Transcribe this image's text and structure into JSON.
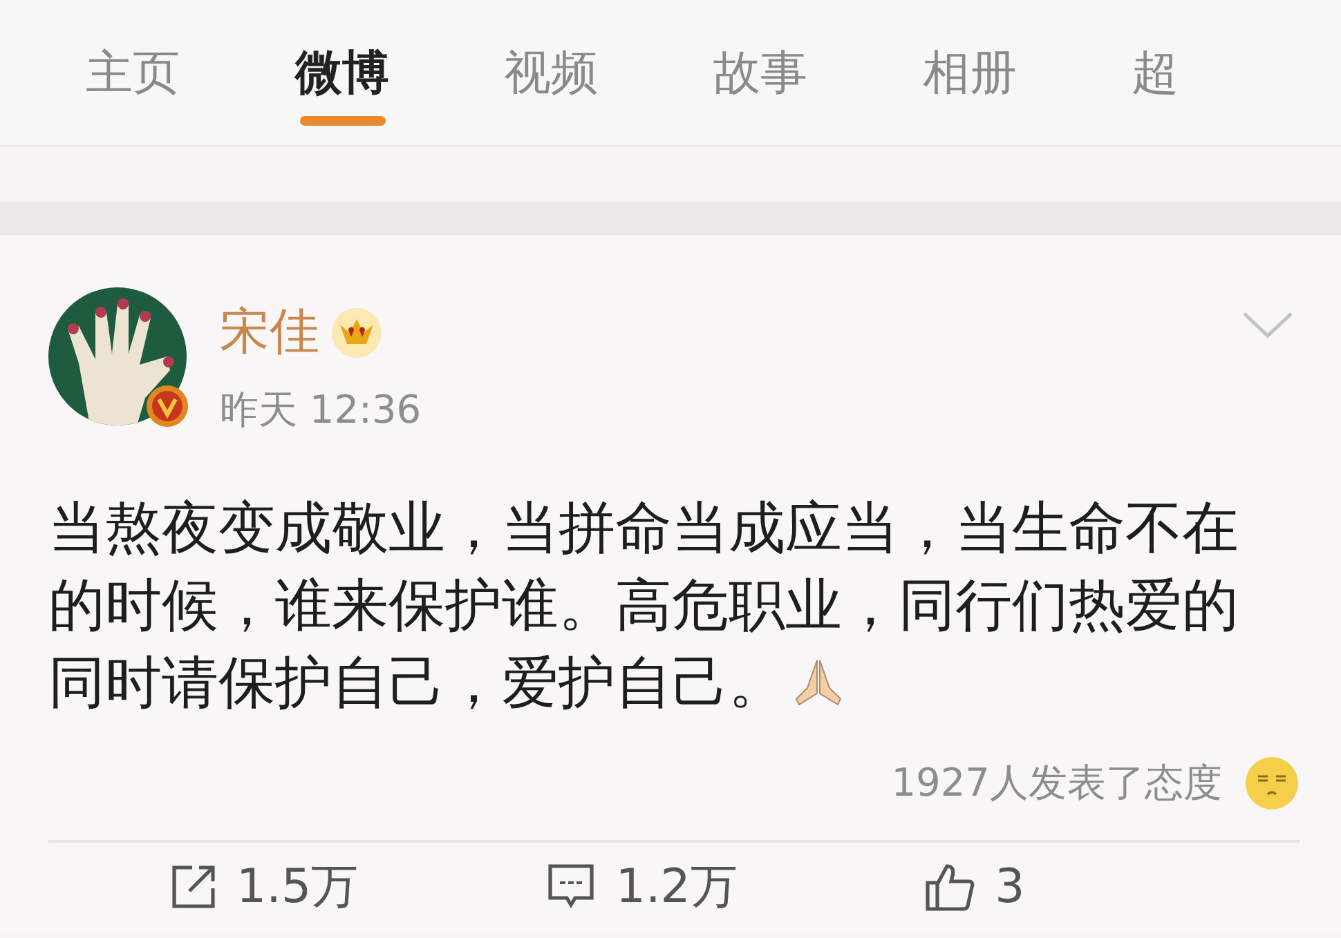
{
  "tabs": [
    {
      "label": "主页",
      "selected": false
    },
    {
      "label": "微博",
      "selected": true
    },
    {
      "label": "视频",
      "selected": false
    },
    {
      "label": "故事",
      "selected": false
    },
    {
      "label": "相册",
      "selected": false
    },
    {
      "label": "超",
      "selected": false
    }
  ],
  "post": {
    "author": "宋佳",
    "verified": true,
    "crown": true,
    "time": "昨天 12:36",
    "lines": [
      "当熬夜变成敬业，当拼命当成应当，当生命不在",
      "的时候，谁来保护谁。高危职业，同行们热爱的",
      "同时请保护自己，爱护自己。"
    ],
    "reactions": "1927人发表了态度"
  },
  "actions": [
    {
      "kind": "repost",
      "count": "1.5万"
    },
    {
      "kind": "comment",
      "count": "1.2万"
    },
    {
      "kind": "like",
      "count": "3"
    }
  ]
}
